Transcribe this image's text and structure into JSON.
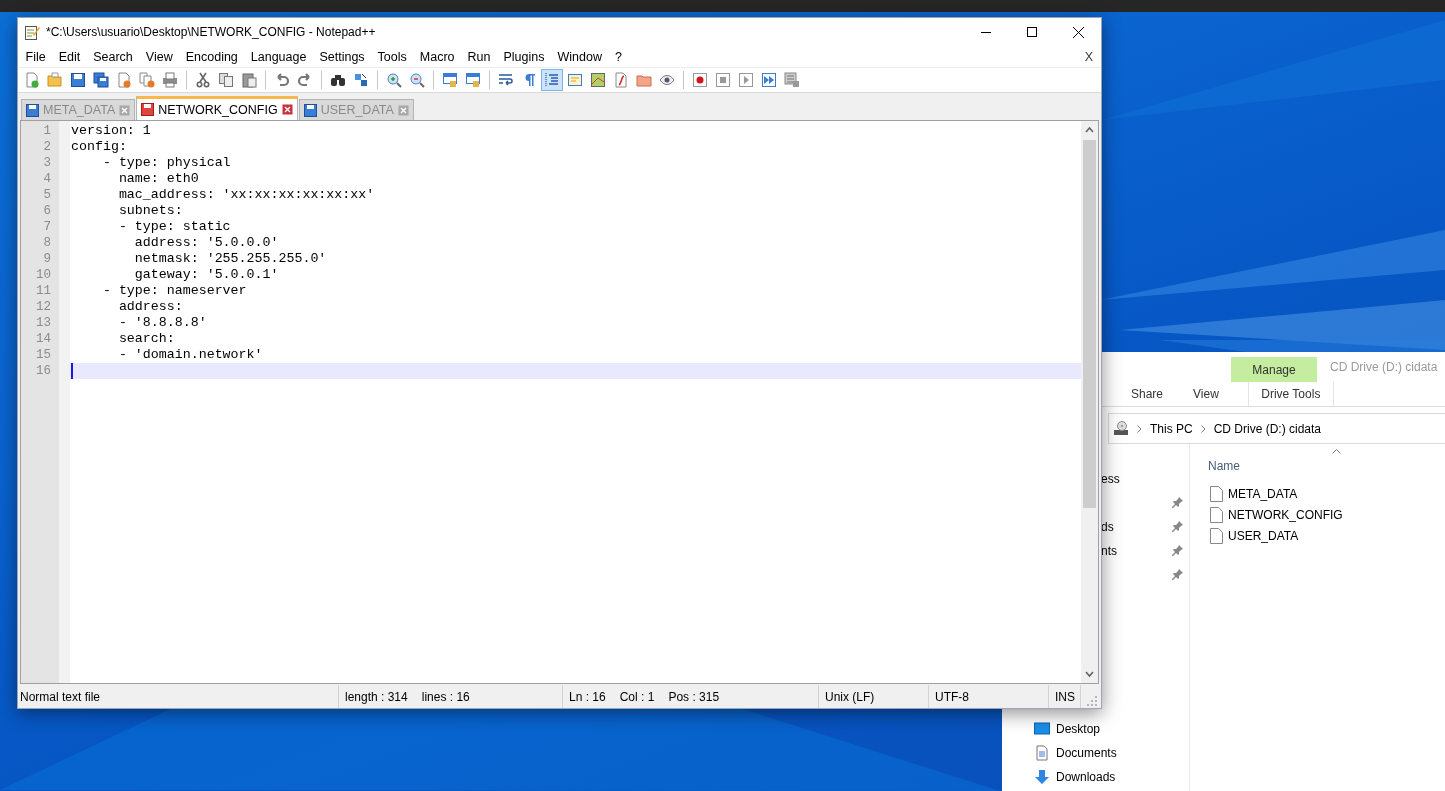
{
  "notepad": {
    "title": "*C:\\Users\\usuario\\Desktop\\NETWORK_CONFIG - Notepad++",
    "menu": [
      "File",
      "Edit",
      "Search",
      "View",
      "Encoding",
      "Language",
      "Settings",
      "Tools",
      "Macro",
      "Run",
      "Plugins",
      "Window",
      "?"
    ],
    "close_document": "X",
    "toolbar": [
      {
        "on": false
      },
      {
        "on": false
      },
      {
        "on": false
      },
      {
        "on": false
      },
      {
        "on": false
      },
      {
        "on": false
      },
      {
        "on": false
      },
      {
        "on": false
      },
      {
        "on": false
      },
      {
        "on": false
      },
      {
        "on": false
      },
      {
        "on": false
      },
      {
        "on": false
      },
      {
        "on": false
      },
      {
        "on": false
      },
      {
        "on": false
      },
      {
        "on": false
      },
      {
        "on": false
      },
      {
        "on": false
      },
      {
        "on": false
      },
      {
        "on": true
      },
      {
        "on": false
      },
      {
        "on": false
      },
      {
        "on": false
      },
      {
        "on": false
      },
      {
        "on": false
      },
      {
        "on": false
      },
      {
        "on": false
      },
      {
        "on": false
      },
      {
        "on": false
      },
      {
        "on": false
      }
    ],
    "tabs": [
      {
        "label": "META_DATA",
        "selected": false,
        "modified": false
      },
      {
        "label": "NETWORK_CONFIG",
        "selected": true,
        "modified": true
      },
      {
        "label": "USER_DATA",
        "selected": false,
        "modified": false
      }
    ],
    "lines": [
      {
        "number": "1",
        "text": "version: 1",
        "current": false
      },
      {
        "number": "2",
        "text": "config:",
        "current": false
      },
      {
        "number": "3",
        "text": "    - type: physical",
        "current": false
      },
      {
        "number": "4",
        "text": "      name: eth0",
        "current": false
      },
      {
        "number": "5",
        "text": "      mac_address: 'xx:xx:xx:xx:xx:xx'",
        "current": false
      },
      {
        "number": "6",
        "text": "      subnets:",
        "current": false
      },
      {
        "number": "7",
        "text": "      - type: static",
        "current": false
      },
      {
        "number": "8",
        "text": "        address: '5.0.0.0'",
        "current": false
      },
      {
        "number": "9",
        "text": "        netmask: '255.255.255.0'",
        "current": false
      },
      {
        "number": "10",
        "text": "        gateway: '5.0.0.1'",
        "current": false
      },
      {
        "number": "11",
        "text": "    - type: nameserver",
        "current": false
      },
      {
        "number": "12",
        "text": "      address:",
        "current": false
      },
      {
        "number": "13",
        "text": "      - '8.8.8.8'",
        "current": false
      },
      {
        "number": "14",
        "text": "      search:",
        "current": false
      },
      {
        "number": "15",
        "text": "      - 'domain.network'",
        "current": false
      },
      {
        "number": "16",
        "current": true
      }
    ],
    "status_bar": {
      "file_type": "Normal text file",
      "length": "length : 314",
      "lines": "lines : 16",
      "ln": "Ln : 16",
      "col": "Col : 1",
      "pos": "Pos : 315",
      "eol": "Unix (LF)",
      "encoding": "UTF-8",
      "mode": "INS"
    }
  },
  "explorer": {
    "title": "CD Drive (D:) cidata",
    "context_group": {
      "label": "Manage",
      "tab": "Drive Tools"
    },
    "ribbon_tabs": [
      "Share",
      "View"
    ],
    "address": [
      "This PC",
      "CD Drive (D:) cidata"
    ],
    "quick_access": [
      {
        "text": "ess",
        "pinned": false
      },
      {
        "pinned": true
      },
      {
        "text": "ds",
        "pinned": true
      },
      {
        "text": "nts",
        "pinned": true
      },
      {
        "pinned": true
      }
    ],
    "places": [
      {
        "label": "Desktop",
        "kind": "desktop"
      },
      {
        "label": "Documents",
        "kind": "documents"
      },
      {
        "label": "Downloads",
        "kind": "downloads"
      }
    ],
    "column": "Name",
    "files": [
      "META_DATA",
      "NETWORK_CONFIG",
      "USER_DATA"
    ]
  }
}
